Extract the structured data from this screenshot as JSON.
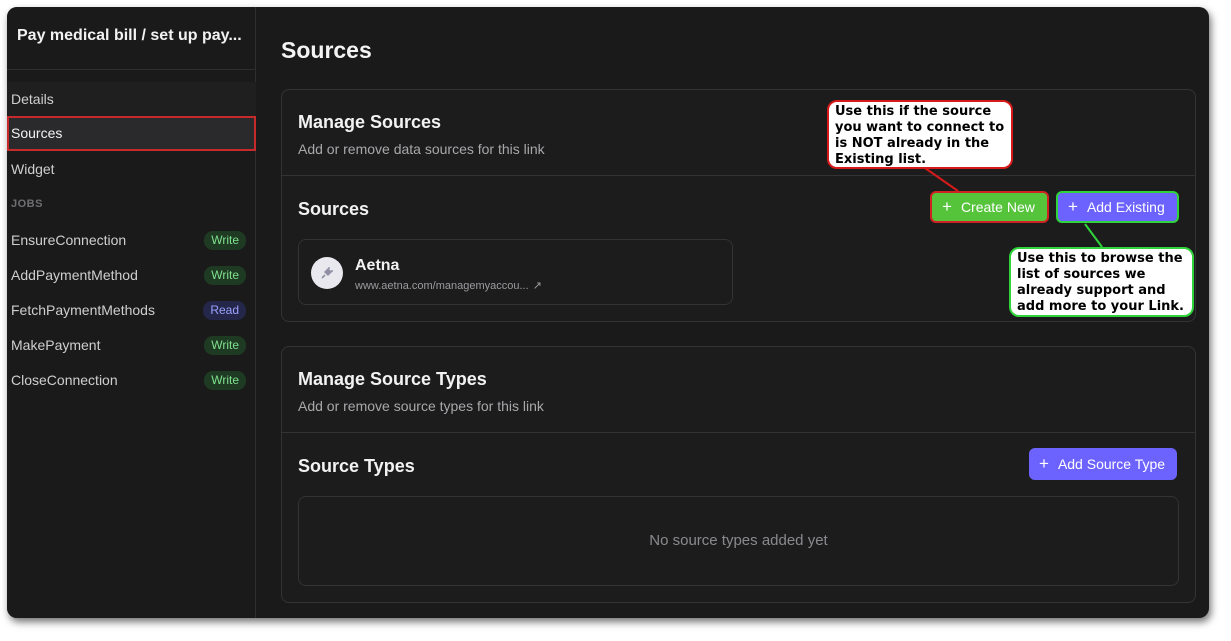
{
  "sidebar": {
    "title": "Pay medical bill / set up pay...",
    "nav": [
      {
        "label": "Details"
      },
      {
        "label": "Sources"
      },
      {
        "label": "Widget"
      }
    ],
    "jobs_heading": "JOBS",
    "jobs": [
      {
        "label": "EnsureConnection",
        "badge": "Write"
      },
      {
        "label": "AddPaymentMethod",
        "badge": "Write"
      },
      {
        "label": "FetchPaymentMethods",
        "badge": "Read"
      },
      {
        "label": "MakePayment",
        "badge": "Write"
      },
      {
        "label": "CloseConnection",
        "badge": "Write"
      }
    ]
  },
  "main": {
    "title": "Sources",
    "manage_sources": {
      "heading": "Manage Sources",
      "subtitle": "Add or remove data sources for this link",
      "list_heading": "Sources",
      "create_new_label": "Create New",
      "add_existing_label": "Add Existing",
      "source": {
        "name": "Aetna",
        "url": "www.aetna.com/managemyaccou..."
      }
    },
    "manage_source_types": {
      "heading": "Manage Source Types",
      "subtitle": "Add or remove source types for this link",
      "list_heading": "Source Types",
      "add_label": "Add Source Type",
      "empty_text": "No source types added yet"
    }
  },
  "callouts": {
    "create_new": "Use this if the source you want to connect to is NOT already in the Existing list.",
    "add_existing": "Use this to browse the list of sources we already support and add more to your Link."
  },
  "colors": {
    "background": "#1a1a1b",
    "accent_purple": "#6c63ff",
    "accent_green": "#56c43b",
    "callout_red": "#d61a1a",
    "callout_green": "#2fd33a"
  }
}
